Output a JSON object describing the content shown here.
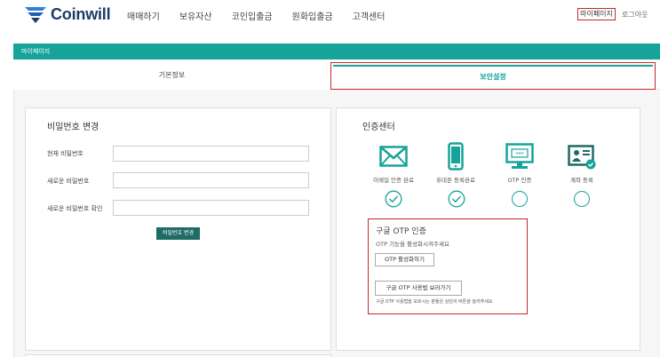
{
  "brand": {
    "name": "Coinwill",
    "color": "#1b3a6b"
  },
  "nav": {
    "items": [
      "매매하기",
      "보유자산",
      "코인입출금",
      "원화입출금",
      "고객센터"
    ]
  },
  "user_menu": {
    "mypage": "마이페이지",
    "logout": "로그아웃"
  },
  "page_bar": {
    "title": "마이페이지",
    "color": "#16a39a"
  },
  "tabs": {
    "basic": "기본정보",
    "security": "보안설정"
  },
  "password": {
    "title": "비밀번호 변경",
    "current_label": "현재 비밀번호",
    "new_label": "새로운 비밀번호",
    "confirm_label": "새로운 비밀번호 확인",
    "current_value": "",
    "new_value": "",
    "confirm_value": "",
    "button": "비밀번호 변경"
  },
  "auth_center": {
    "title": "인증센터",
    "items": [
      {
        "label": "이메일 인증 완료",
        "icon": "envelope-icon",
        "done": true
      },
      {
        "label": "휴대폰 등록완료",
        "icon": "mobile-phone-icon",
        "done": true
      },
      {
        "label": "OTP 인증",
        "icon": "monitor-icon",
        "done": false
      },
      {
        "label": "계좌 등록",
        "icon": "id-card-icon",
        "done": false
      }
    ]
  },
  "otp": {
    "title": "구글 OTP 인증",
    "desc": "OTP 기능을 활성화시켜주세요",
    "activate_button": "OTP 활성화하기",
    "guide_button": "구글 OTP 사용법 보러가기",
    "note": "구글 OTP 사용법을 모르시는 분들은 상단의 버튼을 눌러주세요"
  }
}
